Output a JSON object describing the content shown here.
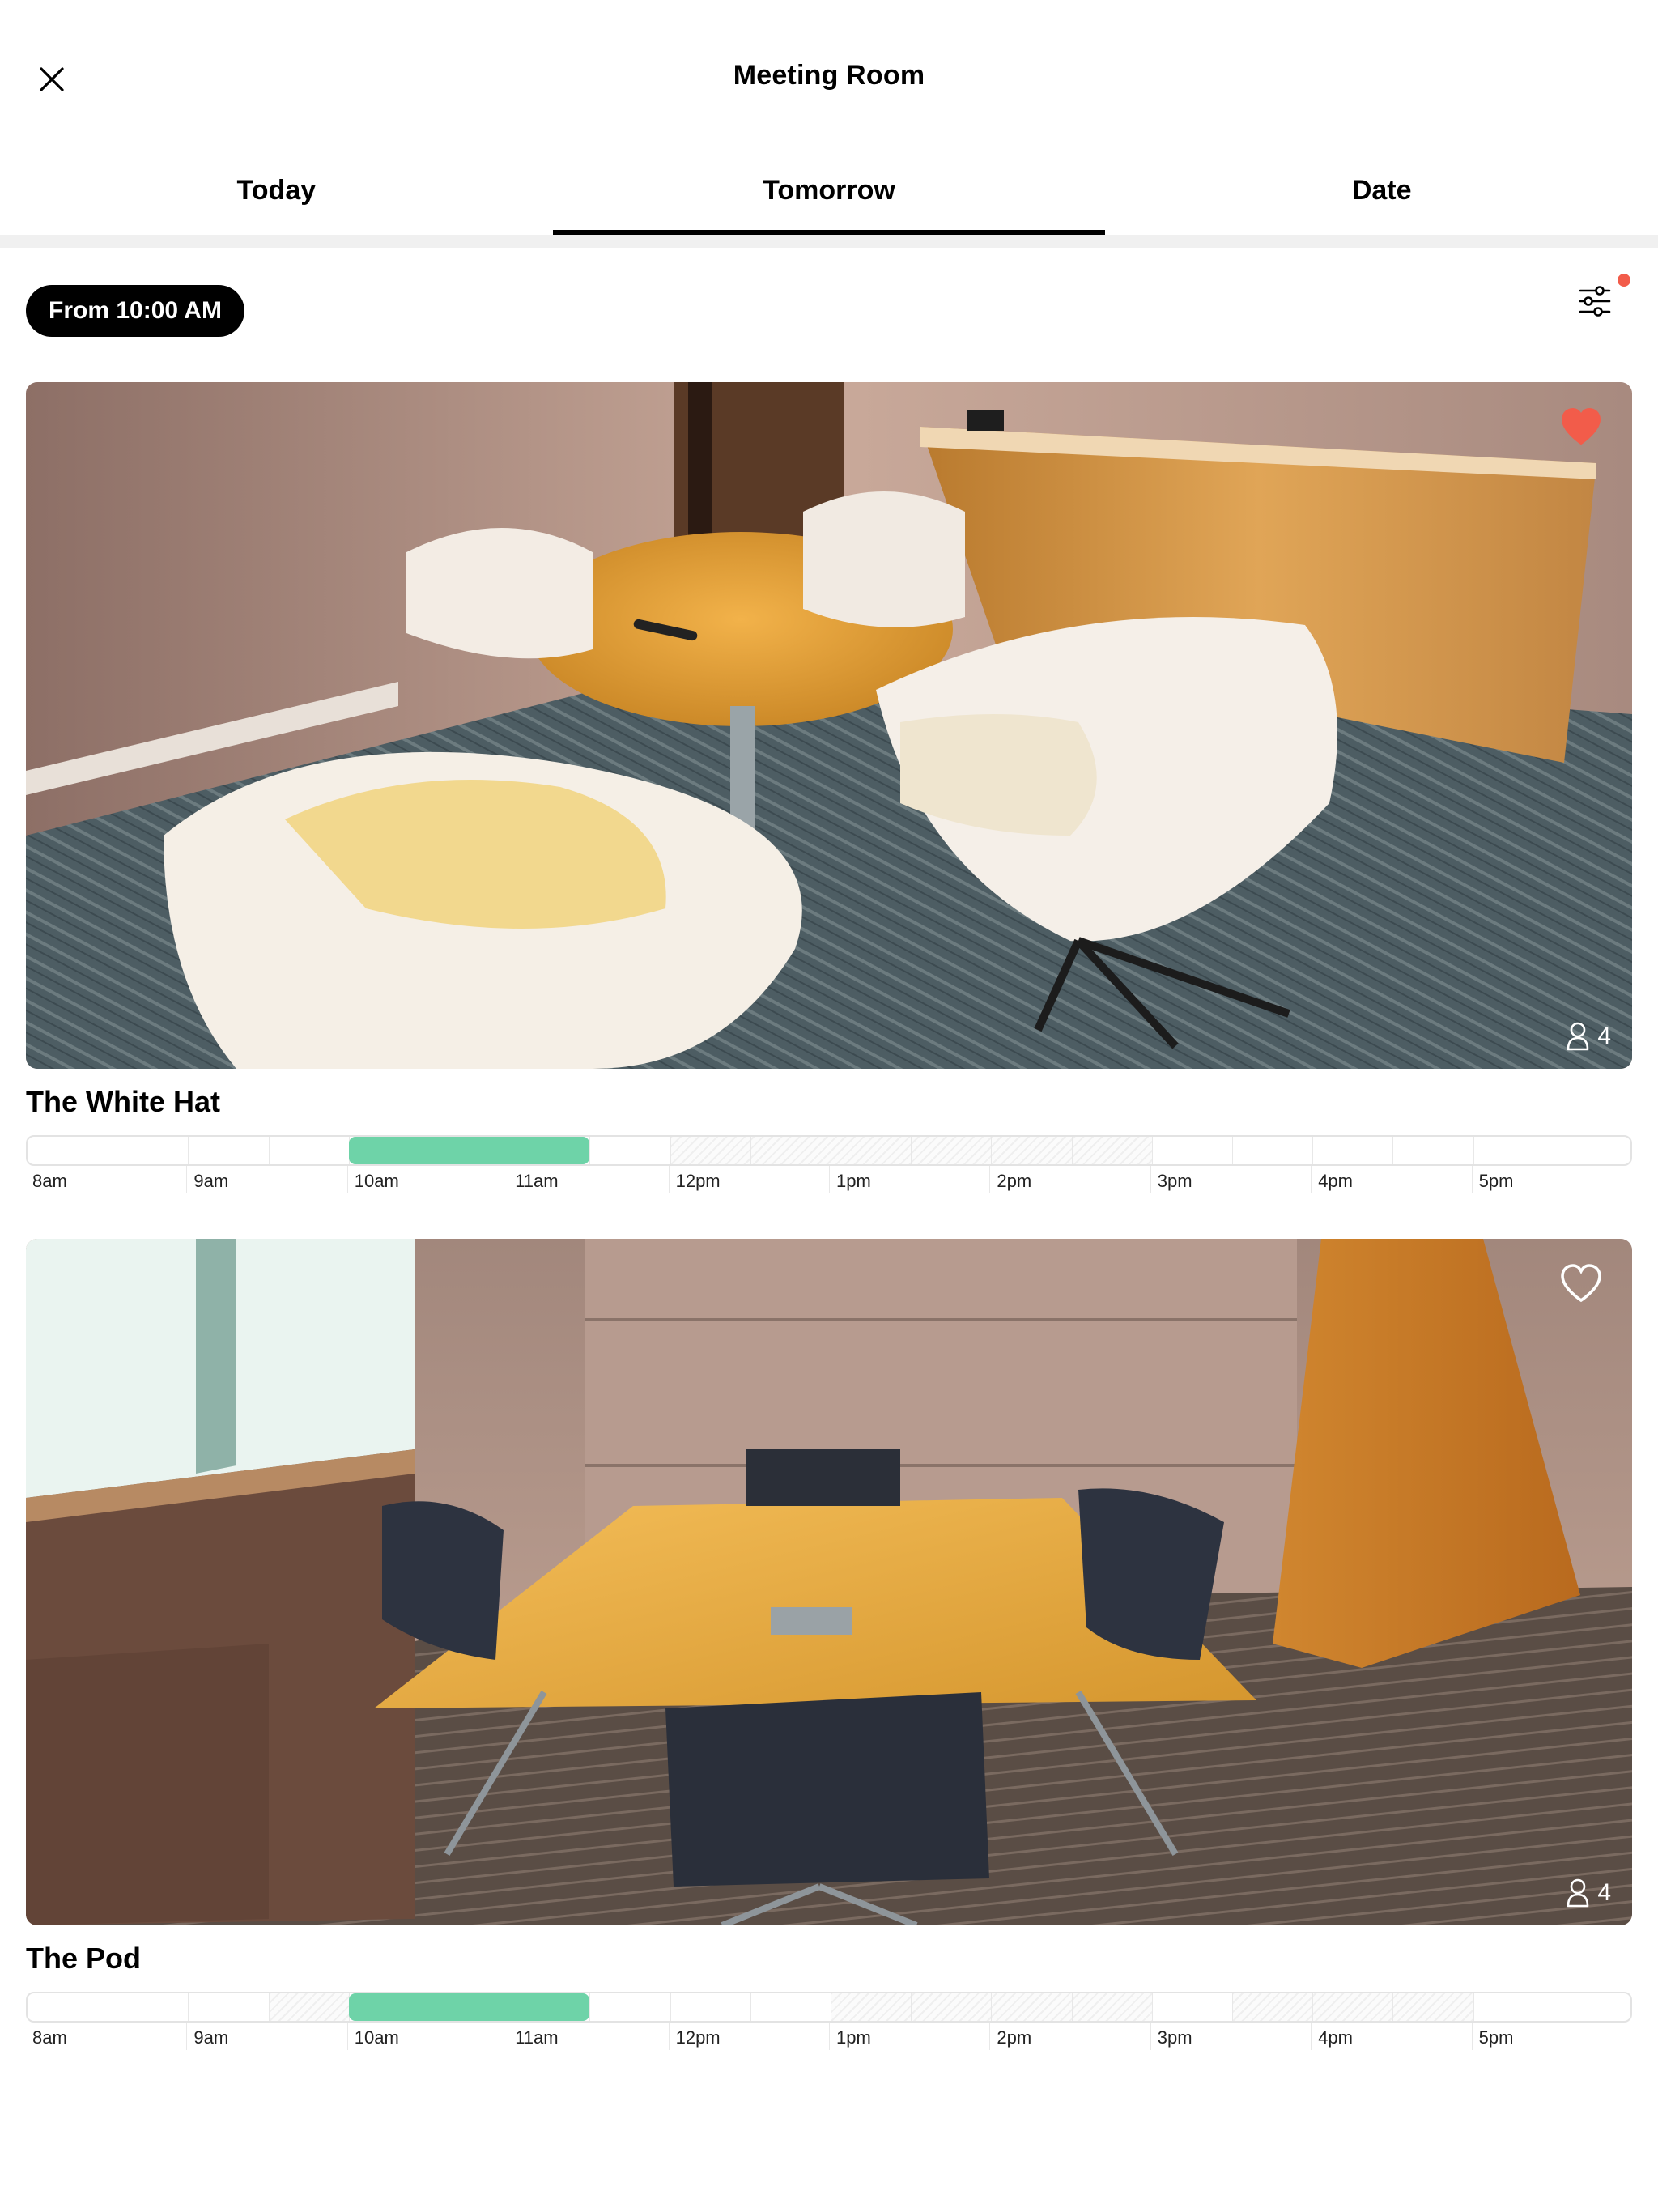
{
  "header": {
    "title": "Meeting Room",
    "close_icon": "close-icon"
  },
  "tabs": [
    {
      "label": "Today",
      "active": false
    },
    {
      "label": "Tomorrow",
      "active": true
    },
    {
      "label": "Date",
      "active": false
    }
  ],
  "filter": {
    "pill_label": "From 10:00 AM",
    "filters_icon": "sliders-icon",
    "has_notification": true
  },
  "time_labels": [
    "8am",
    "9am",
    "10am",
    "11am",
    "12pm",
    "1pm",
    "2pm",
    "3pm",
    "4pm",
    "5pm"
  ],
  "rooms": [
    {
      "name": "The White Hat",
      "capacity": "4",
      "favorite": true,
      "photo": "round wooden table with four white lounge chairs",
      "booked_start_hours": [
        12,
        14
      ],
      "selected_start_hours": [
        10,
        11.5
      ]
    },
    {
      "name": "The Pod",
      "capacity": "4",
      "favorite": false,
      "photo": "square wooden table with four black office chairs",
      "booked_start_hours": [
        9.5,
        10,
        13,
        15.5,
        17
      ],
      "selected_start_hours": [
        10,
        11.5
      ]
    }
  ],
  "colors": {
    "selected": "#6ed3a8",
    "notification": "#f25c4a",
    "favorite": "#f25c4a",
    "pill_bg": "#000000"
  }
}
